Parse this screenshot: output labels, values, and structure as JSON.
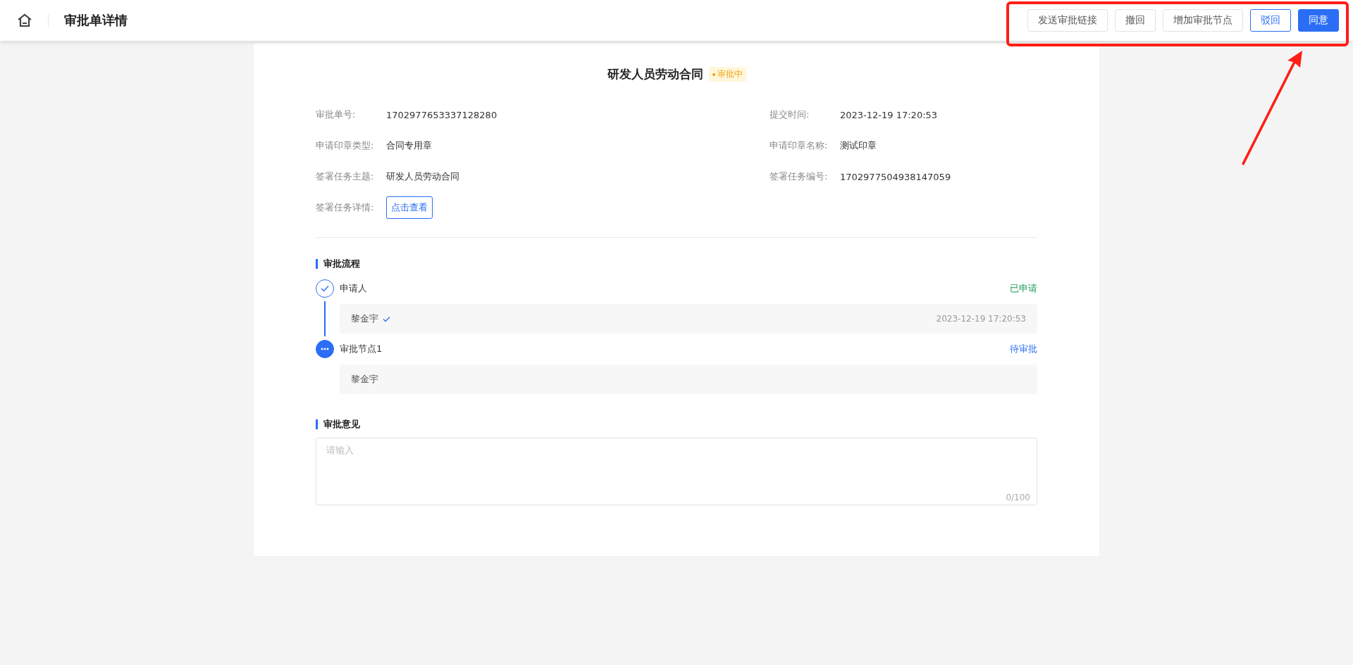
{
  "header": {
    "title": "审批单详情"
  },
  "actions": [
    {
      "label": "发送审批链接",
      "kind": "default"
    },
    {
      "label": "撤回",
      "kind": "default"
    },
    {
      "label": "增加审批节点",
      "kind": "default"
    },
    {
      "label": "驳回",
      "kind": "outline"
    },
    {
      "label": "同意",
      "kind": "primary"
    }
  ],
  "document": {
    "title": "研发人员劳动合同",
    "status": "审批中"
  },
  "field_rows": [
    [
      {
        "label": "审批单号:",
        "value": "1702977653337128280",
        "kind": "text"
      },
      {
        "label": "提交时间:",
        "value": "2023-12-19 17:20:53",
        "kind": "text"
      }
    ],
    [
      {
        "label": "申请印章类型:",
        "value": "合同专用章",
        "kind": "text"
      },
      {
        "label": "申请印章名称:",
        "value": "测试印章",
        "kind": "text"
      }
    ],
    [
      {
        "label": "签署任务主题:",
        "value": "研发人员劳动合同",
        "kind": "text"
      },
      {
        "label": "签署任务编号:",
        "value": "1702977504938147059",
        "kind": "text"
      }
    ],
    [
      {
        "label": "签署任务详情:",
        "value": "点击查看",
        "kind": "link"
      }
    ]
  ],
  "flow": {
    "title": "审批流程",
    "steps": [
      {
        "name": "申请人",
        "status": "已申请",
        "done": true,
        "entries": [
          {
            "name": "黎金宇",
            "verified": true,
            "time": "2023-12-19 17:20:53"
          }
        ]
      },
      {
        "name": "审批节点1",
        "status": "待审批",
        "done": false,
        "entries": [
          {
            "name": "黎金宇",
            "verified": false
          }
        ]
      }
    ]
  },
  "opinion": {
    "title": "审批意见",
    "placeholder": "请输入",
    "counter": "0/100"
  }
}
